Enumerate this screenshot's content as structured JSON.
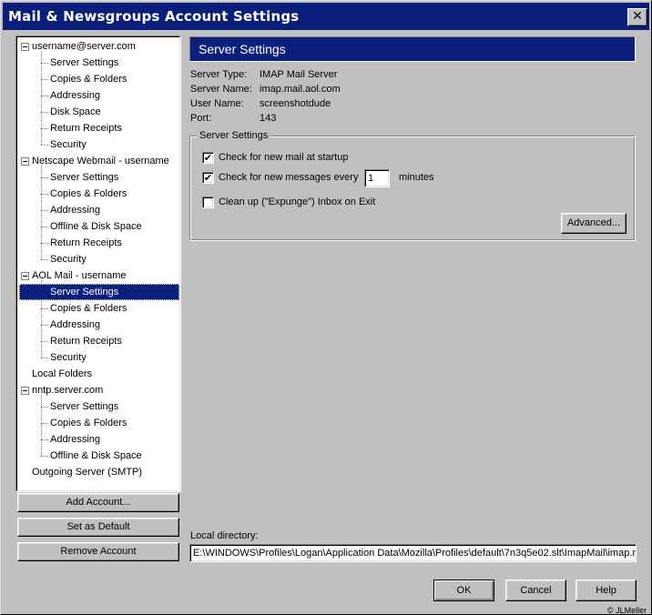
{
  "window": {
    "title": "Mail & Newsgroups Account Settings",
    "close_glyph": "✕"
  },
  "tree": {
    "accounts": [
      {
        "name": "username@server.com",
        "children": [
          "Server Settings",
          "Copies & Folders",
          "Addressing",
          "Disk Space",
          "Return Receipts",
          "Security"
        ]
      },
      {
        "name": "Netscape Webmail - username",
        "children": [
          "Server Settings",
          "Copies & Folders",
          "Addressing",
          "Offline & Disk Space",
          "Return Receipts",
          "Security"
        ]
      },
      {
        "name": "AOL Mail - username",
        "children": [
          "Server Settings",
          "Copies & Folders",
          "Addressing",
          "Return Receipts",
          "Security"
        ]
      },
      {
        "name": "Local Folders",
        "children": []
      },
      {
        "name": "nntp.server.com",
        "children": [
          "Server Settings",
          "Copies & Folders",
          "Addressing",
          "Offline & Disk Space"
        ]
      },
      {
        "name": "Outgoing Server (SMTP)",
        "children": []
      }
    ],
    "selected": "AOL Mail - username / Server Settings"
  },
  "left_buttons": {
    "add_account": "Add Account...",
    "set_default": "Set as Default",
    "remove_account": "Remove Account"
  },
  "panel": {
    "title": "Server Settings",
    "info": {
      "server_type_label": "Server Type:",
      "server_type_value": "IMAP Mail Server",
      "server_name_label": "Server Name:",
      "server_name_value": "imap.mail.aol.com",
      "user_name_label": "User Name:",
      "user_name_value": "screenshotdude",
      "port_label": "Port:",
      "port_value": "143"
    },
    "group": {
      "title": "Server Settings",
      "check_startup_label": "Check for new mail at startup",
      "check_startup_checked": true,
      "check_every_label": "Check for new messages every",
      "check_every_checked": true,
      "interval_value": "1",
      "interval_unit": "minutes",
      "expunge_label": "Clean up (\"Expunge\") Inbox on Exit",
      "expunge_checked": false,
      "advanced_button": "Advanced..."
    },
    "local_directory_label": "Local directory:",
    "local_directory_value": "E:\\WINDOWS\\Profiles\\Logan\\Application Data\\Mozilla\\Profiles\\default\\7n3q5e02.slt\\ImapMail\\imap.mail.aol.com"
  },
  "footer_buttons": {
    "ok": "OK",
    "cancel": "Cancel",
    "help": "Help"
  },
  "copyright": "© JLMeller",
  "check_glyph": "✔"
}
